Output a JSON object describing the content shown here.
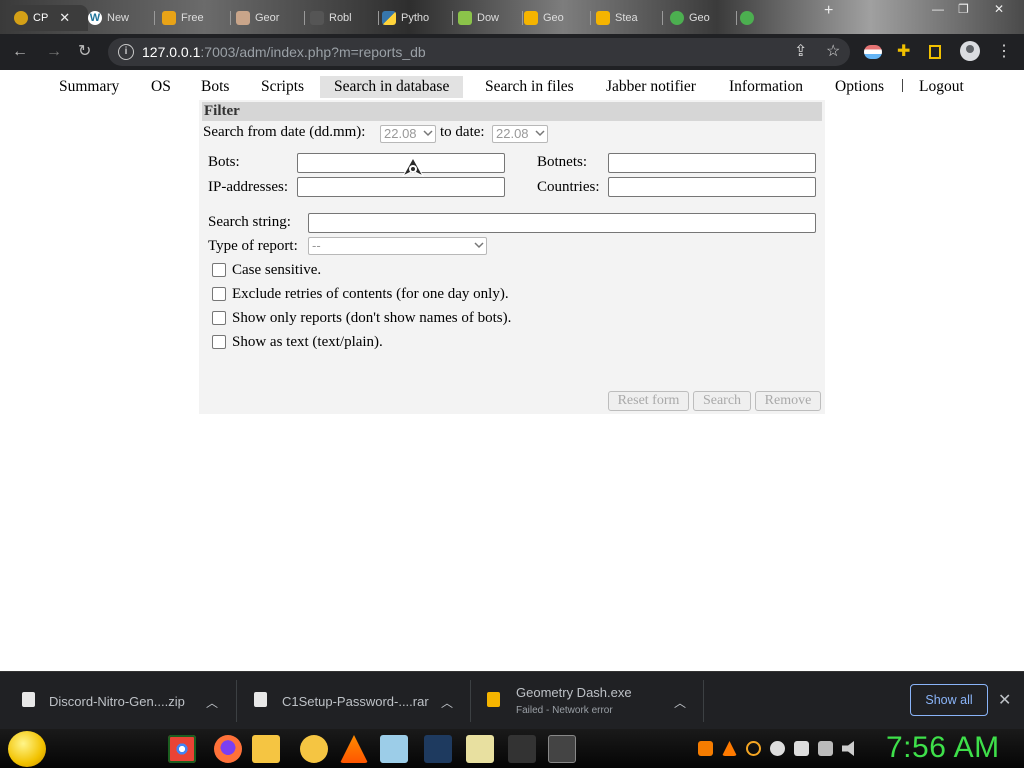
{
  "browser": {
    "tabs": [
      {
        "label": "CP",
        "active": true
      },
      {
        "label": "New",
        "active": false
      },
      {
        "label": "Free",
        "active": false
      },
      {
        "label": "Geor",
        "active": false
      },
      {
        "label": "Robl",
        "active": false
      },
      {
        "label": "Pytho",
        "active": false
      },
      {
        "label": "Dow",
        "active": false
      },
      {
        "label": "Geo",
        "active": false
      },
      {
        "label": "Stea",
        "active": false
      },
      {
        "label": "Geo",
        "active": false
      }
    ],
    "url_host": "127.0.0.1",
    "url_rest": ":7003/adm/index.php?m=reports_db"
  },
  "nav": {
    "items": [
      "Summary",
      "OS",
      "Bots",
      "Scripts",
      "Search in database",
      "Search in files",
      "Jabber notifier",
      "Information",
      "Options"
    ],
    "separator": "|",
    "logout": "Logout",
    "active": "Search in database"
  },
  "filter": {
    "header": "Filter",
    "date_from_label": "Search from date (dd.mm):",
    "date_from_value": "22.08",
    "to_date_label": "to date:",
    "date_to_value": "22.08",
    "bots_label": "Bots:",
    "bots_value": "",
    "botnets_label": "Botnets:",
    "botnets_value": "",
    "ip_label": "IP-addresses:",
    "ip_value": "",
    "countries_label": "Countries:",
    "countries_value": "",
    "search_string_label": "Search string:",
    "search_string_value": "",
    "type_label": "Type of report:",
    "type_value": "--",
    "checkboxes": [
      {
        "label": "Case sensitive.",
        "checked": false
      },
      {
        "label": "Exclude retries of contents (for one day only).",
        "checked": false
      },
      {
        "label": "Show only reports (don't show names of bots).",
        "checked": false
      },
      {
        "label": "Show as text (text/plain).",
        "checked": false
      }
    ],
    "buttons": {
      "reset": "Reset form",
      "search": "Search",
      "remove": "Remove"
    }
  },
  "downloads": {
    "items": [
      {
        "name": "Discord-Nitro-Gen....zip",
        "status": ""
      },
      {
        "name": "C1Setup-Password-....rar",
        "status": ""
      },
      {
        "name": "Geometry Dash.exe",
        "status": "Failed - Network error"
      }
    ],
    "show_all": "Show all"
  },
  "taskbar": {
    "clock": "7:56 AM"
  },
  "colors": {
    "clock": "#3ee04a",
    "show_all": "#8ab4f8",
    "active_nav_bg": "#e2e2e2",
    "panel_bg": "#f3f3f3"
  }
}
